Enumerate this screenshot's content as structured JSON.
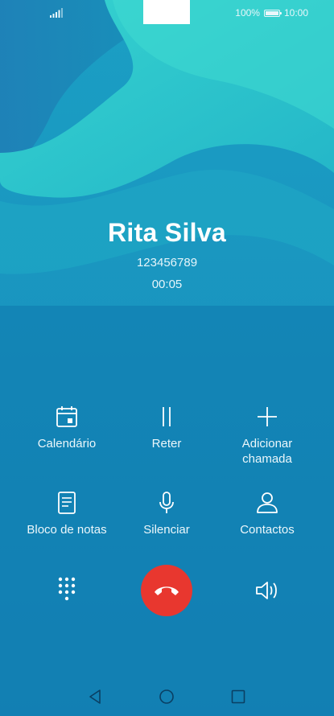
{
  "status_bar": {
    "battery_text": "100%",
    "time": "10:00",
    "icons": [
      "signal-icon",
      "battery-icon"
    ]
  },
  "call": {
    "caller_name": "Rita Silva",
    "number": "123456789",
    "duration": "00:05"
  },
  "actions": {
    "calendar": {
      "label": "Calendário",
      "icon": "calendar-icon"
    },
    "hold": {
      "label": "Reter",
      "icon": "pause-icon"
    },
    "add_call": {
      "label": "Adicionar\nchamada",
      "icon": "plus-icon"
    },
    "notepad": {
      "label": "Bloco de notas",
      "icon": "notepad-icon"
    },
    "mute": {
      "label": "Silenciar",
      "icon": "microphone-icon"
    },
    "contacts": {
      "label": "Contactos",
      "icon": "person-icon"
    }
  },
  "controls": {
    "keypad_icon": "keypad-icon",
    "end_call_icon": "hang-up-icon",
    "speaker_icon": "speaker-icon",
    "end_call_color": "#e8372f"
  },
  "nav": {
    "icons": [
      "back-icon",
      "home-icon",
      "recent-apps-icon"
    ]
  },
  "colors": {
    "background_top": "#1ea9bf",
    "background_bottom": "#0d6fa8",
    "text": "#ffffff"
  }
}
